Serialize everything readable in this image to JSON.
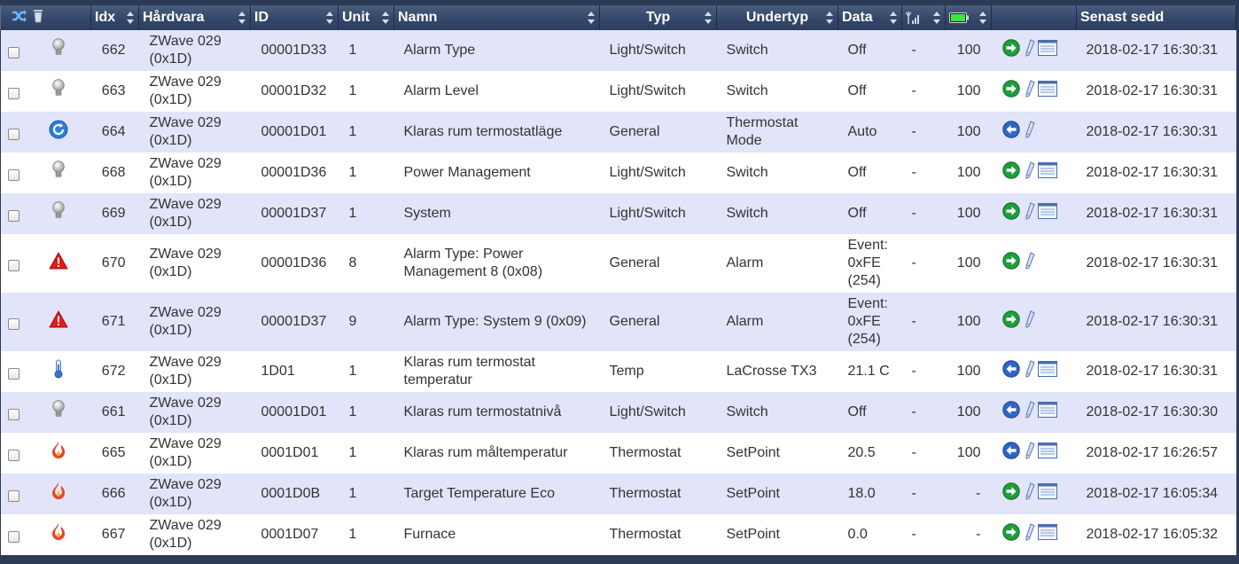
{
  "columns": {
    "idx": "Idx",
    "hardware": "Hårdvara",
    "id": "ID",
    "unit": "Unit",
    "name": "Namn",
    "type": "Typ",
    "subtype": "Undertyp",
    "data": "Data",
    "last_seen": "Senast sedd"
  },
  "header_icons": [
    "shuffle-icon",
    "trash-icon",
    "signal-icon",
    "battery-icon"
  ],
  "rows": [
    {
      "icon": "bulb-icon",
      "idx": "662",
      "hardware": "ZWave 029 (0x1D)",
      "id": "00001D33",
      "unit": "1",
      "name": "Alarm Type",
      "type": "Light/Switch",
      "subtype": "Switch",
      "data": "Off",
      "signal": "-",
      "battery": "100",
      "actions": [
        "green-arrow-icon",
        "edit-icon",
        "log-icon"
      ],
      "last_seen": "2018-02-17 16:30:31"
    },
    {
      "icon": "bulb-icon",
      "idx": "663",
      "hardware": "ZWave 029 (0x1D)",
      "id": "00001D32",
      "unit": "1",
      "name": "Alarm Level",
      "type": "Light/Switch",
      "subtype": "Switch",
      "data": "Off",
      "signal": "-",
      "battery": "100",
      "actions": [
        "green-arrow-icon",
        "edit-icon",
        "log-icon"
      ],
      "last_seen": "2018-02-17 16:30:31"
    },
    {
      "icon": "refresh-icon",
      "idx": "664",
      "hardware": "ZWave 029 (0x1D)",
      "id": "00001D01",
      "unit": "1",
      "name": "Klaras rum termostatläge",
      "type": "General",
      "subtype": "Thermostat Mode",
      "data": "Auto",
      "signal": "-",
      "battery": "100",
      "actions": [
        "blue-arrow-icon",
        "edit-icon"
      ],
      "last_seen": "2018-02-17 16:30:31"
    },
    {
      "icon": "bulb-icon",
      "idx": "668",
      "hardware": "ZWave 029 (0x1D)",
      "id": "00001D36",
      "unit": "1",
      "name": "Power Management",
      "type": "Light/Switch",
      "subtype": "Switch",
      "data": "Off",
      "signal": "-",
      "battery": "100",
      "actions": [
        "green-arrow-icon",
        "edit-icon",
        "log-icon"
      ],
      "last_seen": "2018-02-17 16:30:31"
    },
    {
      "icon": "bulb-icon",
      "idx": "669",
      "hardware": "ZWave 029 (0x1D)",
      "id": "00001D37",
      "unit": "1",
      "name": "System",
      "type": "Light/Switch",
      "subtype": "Switch",
      "data": "Off",
      "signal": "-",
      "battery": "100",
      "actions": [
        "green-arrow-icon",
        "edit-icon",
        "log-icon"
      ],
      "last_seen": "2018-02-17 16:30:31"
    },
    {
      "icon": "alert-icon",
      "idx": "670",
      "hardware": "ZWave 029 (0x1D)",
      "id": "00001D36",
      "unit": "8",
      "name": "Alarm Type: Power Management 8 (0x08)",
      "type": "General",
      "subtype": "Alarm",
      "data": "Event: 0xFE (254)",
      "signal": "-",
      "battery": "100",
      "actions": [
        "green-arrow-icon",
        "edit-icon"
      ],
      "last_seen": "2018-02-17 16:30:31",
      "tall": true
    },
    {
      "icon": "alert-icon",
      "idx": "671",
      "hardware": "ZWave 029 (0x1D)",
      "id": "00001D37",
      "unit": "9",
      "name": "Alarm Type: System 9 (0x09)",
      "type": "General",
      "subtype": "Alarm",
      "data": "Event: 0xFE (254)",
      "signal": "-",
      "battery": "100",
      "actions": [
        "green-arrow-icon",
        "edit-icon"
      ],
      "last_seen": "2018-02-17 16:30:31",
      "tall": true
    },
    {
      "icon": "thermometer-icon",
      "idx": "672",
      "hardware": "ZWave 029 (0x1D)",
      "id": "1D01",
      "unit": "1",
      "name": "Klaras rum termostat temperatur",
      "type": "Temp",
      "subtype": "LaCrosse TX3",
      "data": "21.1 C",
      "signal": "-",
      "battery": "100",
      "actions": [
        "blue-arrow-icon",
        "edit-icon",
        "log-icon"
      ],
      "last_seen": "2018-02-17 16:30:31"
    },
    {
      "icon": "bulb-icon",
      "idx": "661",
      "hardware": "ZWave 029 (0x1D)",
      "id": "00001D01",
      "unit": "1",
      "name": "Klaras rum termostatnivå",
      "type": "Light/Switch",
      "subtype": "Switch",
      "data": "Off",
      "signal": "-",
      "battery": "100",
      "actions": [
        "blue-arrow-icon",
        "edit-icon",
        "log-icon"
      ],
      "last_seen": "2018-02-17 16:30:30"
    },
    {
      "icon": "flame-icon",
      "idx": "665",
      "hardware": "ZWave 029 (0x1D)",
      "id": "0001D01",
      "unit": "1",
      "name": "Klaras rum måltemperatur",
      "type": "Thermostat",
      "subtype": "SetPoint",
      "data": "20.5",
      "signal": "-",
      "battery": "100",
      "actions": [
        "blue-arrow-icon",
        "edit-icon",
        "log-icon"
      ],
      "last_seen": "2018-02-17 16:26:57"
    },
    {
      "icon": "flame-icon",
      "idx": "666",
      "hardware": "ZWave 029 (0x1D)",
      "id": "0001D0B",
      "unit": "1",
      "name": "Target Temperature Eco",
      "type": "Thermostat",
      "subtype": "SetPoint",
      "data": "18.0",
      "signal": "-",
      "battery": "-",
      "actions": [
        "green-arrow-icon",
        "edit-icon",
        "log-icon"
      ],
      "last_seen": "2018-02-17 16:05:34"
    },
    {
      "icon": "flame-icon",
      "idx": "667",
      "hardware": "ZWave 029 (0x1D)",
      "id": "0001D07",
      "unit": "1",
      "name": "Furnace",
      "type": "Thermostat",
      "subtype": "SetPoint",
      "data": "0.0",
      "signal": "-",
      "battery": "-",
      "actions": [
        "green-arrow-icon",
        "edit-icon",
        "log-icon"
      ],
      "last_seen": "2018-02-17 16:05:32"
    }
  ]
}
